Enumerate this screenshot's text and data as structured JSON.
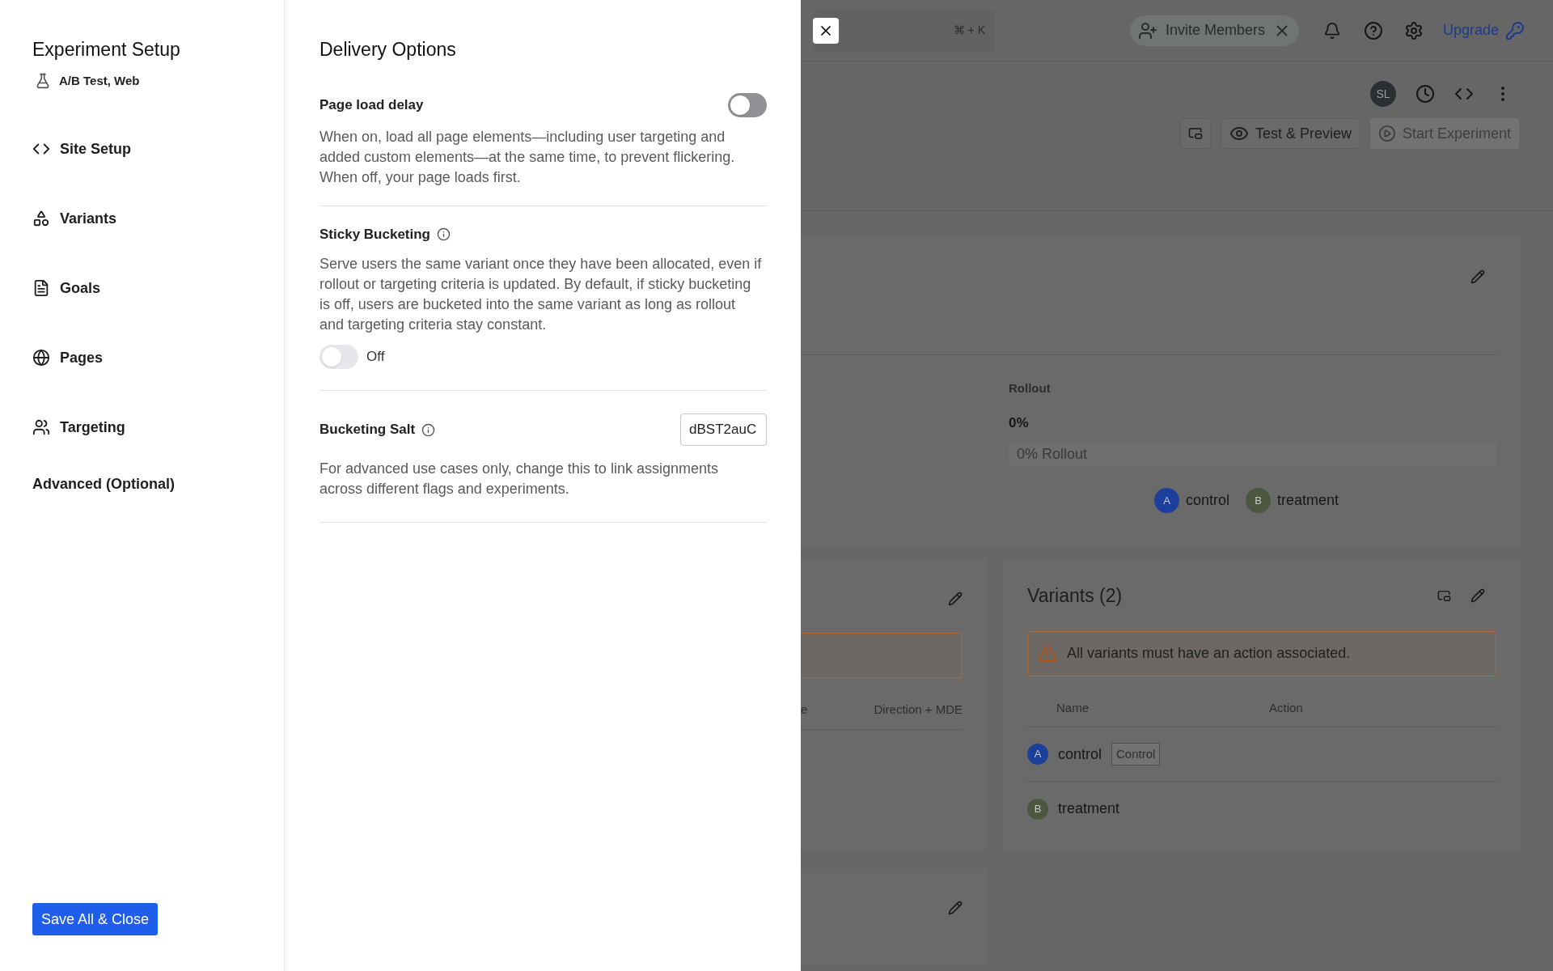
{
  "sidebar": {
    "title": "Experiment Setup",
    "subtitle": "A/B Test, Web",
    "items": [
      {
        "label": "Site Setup"
      },
      {
        "label": "Variants"
      },
      {
        "label": "Goals"
      },
      {
        "label": "Pages"
      },
      {
        "label": "Targeting"
      }
    ],
    "advanced_link": "Advanced (Optional)",
    "save_button": "Save All & Close"
  },
  "panel": {
    "title": "Delivery Options",
    "settings": [
      {
        "kind": "toggle-right",
        "label": "Page load delay",
        "info": false,
        "on": false,
        "disabled": false,
        "description": "When on, load all page elements—including user targeting and added custom elements—at the same time, to prevent flickering. When off, your page loads first."
      },
      {
        "kind": "toggle-below",
        "label": "Sticky Bucketing",
        "info": true,
        "on": false,
        "disabled": true,
        "state_label": "Off",
        "description": "Serve users the same variant once they have been allocated, even if rollout or targeting criteria is updated. By default, if sticky bucketing is off, users are bucketed into the same variant as long as rollout and targeting criteria stay constant."
      },
      {
        "kind": "text-input",
        "label": "Bucketing Salt",
        "info": true,
        "value": "dBST2auC",
        "description": "For advanced use cases only, change this to link assignments across different flags and experiments."
      }
    ]
  },
  "background": {
    "search_shortcut": "⌘ + K",
    "invite": "Invite Members",
    "upgrade": "Upgrade",
    "avatar": "SL",
    "actions": [
      {
        "label": "Test & Preview",
        "disabled": false
      },
      {
        "label": "Start Experiment",
        "disabled": true
      }
    ],
    "rollout": {
      "label": "Rollout",
      "value": "0%",
      "bar_text": "0% Rollout",
      "legend": [
        {
          "letter": "A",
          "name": "control",
          "color": "#1d3f9c"
        },
        {
          "letter": "B",
          "name": "treatment",
          "color": "#4b573f"
        }
      ]
    },
    "goals_card": {
      "columns": [
        "e",
        "Direction + MDE"
      ]
    },
    "variants_card": {
      "title": "Variants (2)",
      "warning": "All variants must have an action associated.",
      "columns": [
        "Name",
        "Action"
      ],
      "rows": [
        {
          "letter": "A",
          "name": "control",
          "color": "#1d3f9c",
          "badge": "Control"
        },
        {
          "letter": "B",
          "name": "treatment",
          "color": "#4b573f"
        }
      ]
    }
  }
}
